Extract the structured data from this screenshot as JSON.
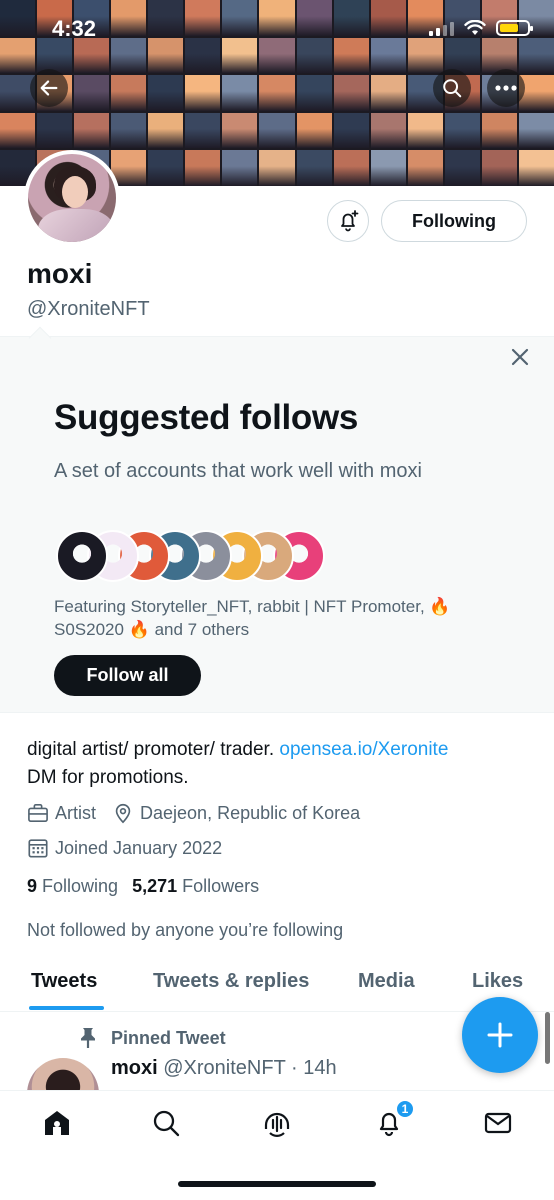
{
  "status_bar": {
    "time": "4:32"
  },
  "banner_tiles": [
    "#1f2a3d",
    "#c96a4a",
    "#3c4f6d",
    "#e39a6a",
    "#2c3346",
    "#d07a5c",
    "#556985",
    "#f0b27a",
    "#6b5470",
    "#2f4256",
    "#a65a4a",
    "#e38b5d",
    "#42506a",
    "#c27c6c",
    "#7b8aa3",
    "#e4a070",
    "#384a64",
    "#b86a55",
    "#5e6d89",
    "#d6936b",
    "#2a3246",
    "#f2c08e",
    "#8f6b78",
    "#39465c",
    "#cf7b58",
    "#6a7a99",
    "#e0a27a",
    "#324055",
    "#b7806d",
    "#4d5e7a",
    "#3f4c66",
    "#e89c6c",
    "#5a4b63",
    "#c77a5c",
    "#2d3a51",
    "#f5b680",
    "#7a8ba6",
    "#d68863",
    "#35455d",
    "#a5675c",
    "#e4ad84",
    "#485a77",
    "#c06a50",
    "#6e7e9a",
    "#f0a46e",
    "#d9845e",
    "#2b3449",
    "#b6705f",
    "#4b5a75",
    "#eab07c",
    "#3a4760",
    "#c98a72",
    "#5d6c88",
    "#e39465",
    "#2f3b52",
    "#a8766e",
    "#f1b98a",
    "#41526d",
    "#cf8561",
    "#7c8ca6",
    "#23293a",
    "#b9735c",
    "#556480",
    "#e7a275",
    "#303c53",
    "#c8795a",
    "#6b7995",
    "#e5b289",
    "#3b4a62",
    "#bb6f58",
    "#8b99b0",
    "#d68d68",
    "#2e374c",
    "#a36458",
    "#f3c193"
  ],
  "profile": {
    "display_name": "moxi",
    "handle": "@XroniteNFT",
    "following_button": "Following"
  },
  "suggested": {
    "title": "Suggested follows",
    "subtitle": "A set of accounts that work well with moxi",
    "featuring": "Featuring Storyteller_NFT, rabbit | NFT Promoter, 🔥 S0S2020 🔥 and 7 others",
    "follow_all": "Follow all",
    "avatar_colors": [
      "#1a1a24",
      "#f3e9f5",
      "#e05a3a",
      "#3f6f8c",
      "#8b8f9c",
      "#f0b040",
      "#d9a97c",
      "#e8407a"
    ]
  },
  "bio": {
    "text": "digital artist/ promoter/ trader. ",
    "link": "opensea.io/Xeronite",
    "line2": "DM for promotions.",
    "profession": "Artist",
    "location": "Daejeon, Republic of Korea",
    "joined": "Joined January 2022"
  },
  "counts": {
    "following_num": "9",
    "following_label": "Following",
    "followers_num": "5,271",
    "followers_label": "Followers"
  },
  "not_followed": "Not followed by anyone you’re following",
  "tabs": [
    {
      "label": "Tweets"
    },
    {
      "label": "Tweets & replies"
    },
    {
      "label": "Media"
    },
    {
      "label": "Likes"
    }
  ],
  "pinned": {
    "label": "Pinned Tweet",
    "name": "moxi",
    "handle_time": "@XroniteNFT · 14h"
  },
  "nav": {
    "notifications_badge": "1"
  },
  "colors": {
    "accent": "#1d9bf0",
    "text": "#0f1419",
    "secondary": "#536471"
  }
}
